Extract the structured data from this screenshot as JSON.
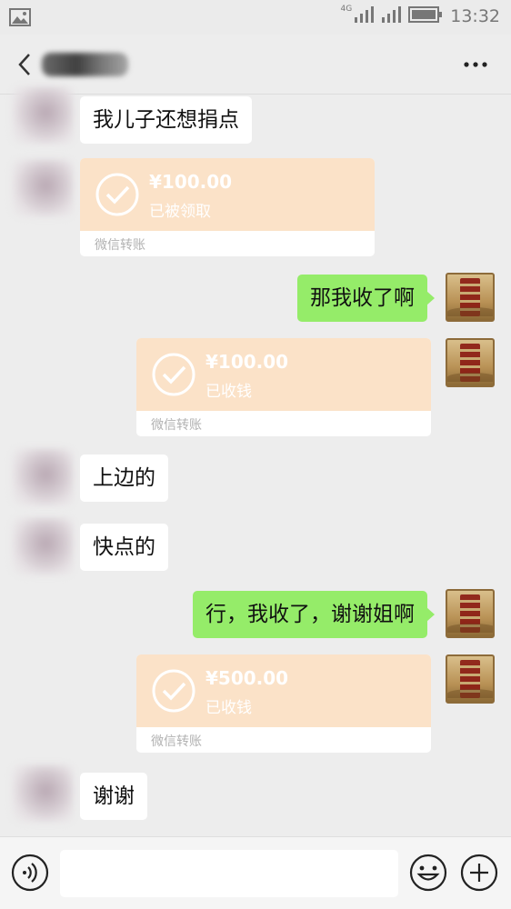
{
  "status_bar": {
    "network": "4G",
    "time": "13:32"
  },
  "header": {
    "back_icon": "chevron-left-icon",
    "more_icon": "more-dots-icon"
  },
  "messages": [
    {
      "type": "text",
      "side": "in",
      "text": "我儿子还想捐点"
    },
    {
      "type": "transfer",
      "side": "in",
      "amount": "¥100.00",
      "status": "已被领取",
      "label": "微信转账"
    },
    {
      "type": "text",
      "side": "out",
      "text": "那我收了啊"
    },
    {
      "type": "transfer",
      "side": "out",
      "amount": "¥100.00",
      "status": "已收钱",
      "label": "微信转账"
    },
    {
      "type": "text",
      "side": "in",
      "text": "上边的"
    },
    {
      "type": "text",
      "side": "in",
      "text": "快点的"
    },
    {
      "type": "text",
      "side": "out",
      "text": "行，我收了，谢谢姐啊"
    },
    {
      "type": "transfer",
      "side": "out",
      "amount": "¥500.00",
      "status": "已收钱",
      "label": "微信转账"
    },
    {
      "type": "text",
      "side": "in",
      "text": "谢谢"
    }
  ],
  "input_bar": {
    "placeholder": "",
    "voice_icon": "voice-icon",
    "emoji_icon": "emoji-icon",
    "plus_icon": "plus-icon"
  },
  "colors": {
    "background": "#ededed",
    "outgoing_bubble": "#95ec69",
    "incoming_bubble": "#ffffff",
    "transfer_card": "#fbe2c8"
  }
}
